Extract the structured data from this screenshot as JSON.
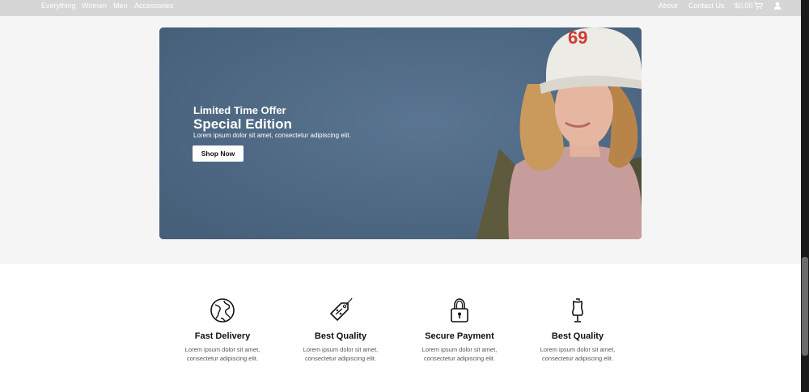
{
  "nav": {
    "left_links": [
      "Everything",
      "Women",
      "Men",
      "Accessories"
    ],
    "about": "About",
    "contact": "Contact Us",
    "cart_total": "$0.00",
    "cart_icon": "cart-icon",
    "user_icon": "user-icon"
  },
  "hero": {
    "kicker": "Limited Time Offer",
    "title": "Special Edition",
    "description": "Lorem ipsum dolor sit amet, consectetur adipiscing elit.",
    "button": "Shop Now",
    "background_color": "#4f6a84"
  },
  "features": [
    {
      "icon": "globe-icon",
      "title": "Fast Delivery",
      "desc_line1": "Lorem ipsum dolor sit amet,",
      "desc_line2": "consectetur adipiscing elit."
    },
    {
      "icon": "price-tag-icon",
      "title": "Best Quality",
      "desc_line1": "Lorem ipsum dolor sit amet,",
      "desc_line2": "consectetur adipiscing elit."
    },
    {
      "icon": "padlock-icon",
      "title": "Secure Payment",
      "desc_line1": "Lorem ipsum dolor sit amet,",
      "desc_line2": "consectetur adipiscing elit."
    },
    {
      "icon": "mannequin-icon",
      "title": "Best Quality",
      "desc_line1": "Lorem ipsum dolor sit amet,",
      "desc_line2": "consectetur adipiscing elit."
    }
  ]
}
